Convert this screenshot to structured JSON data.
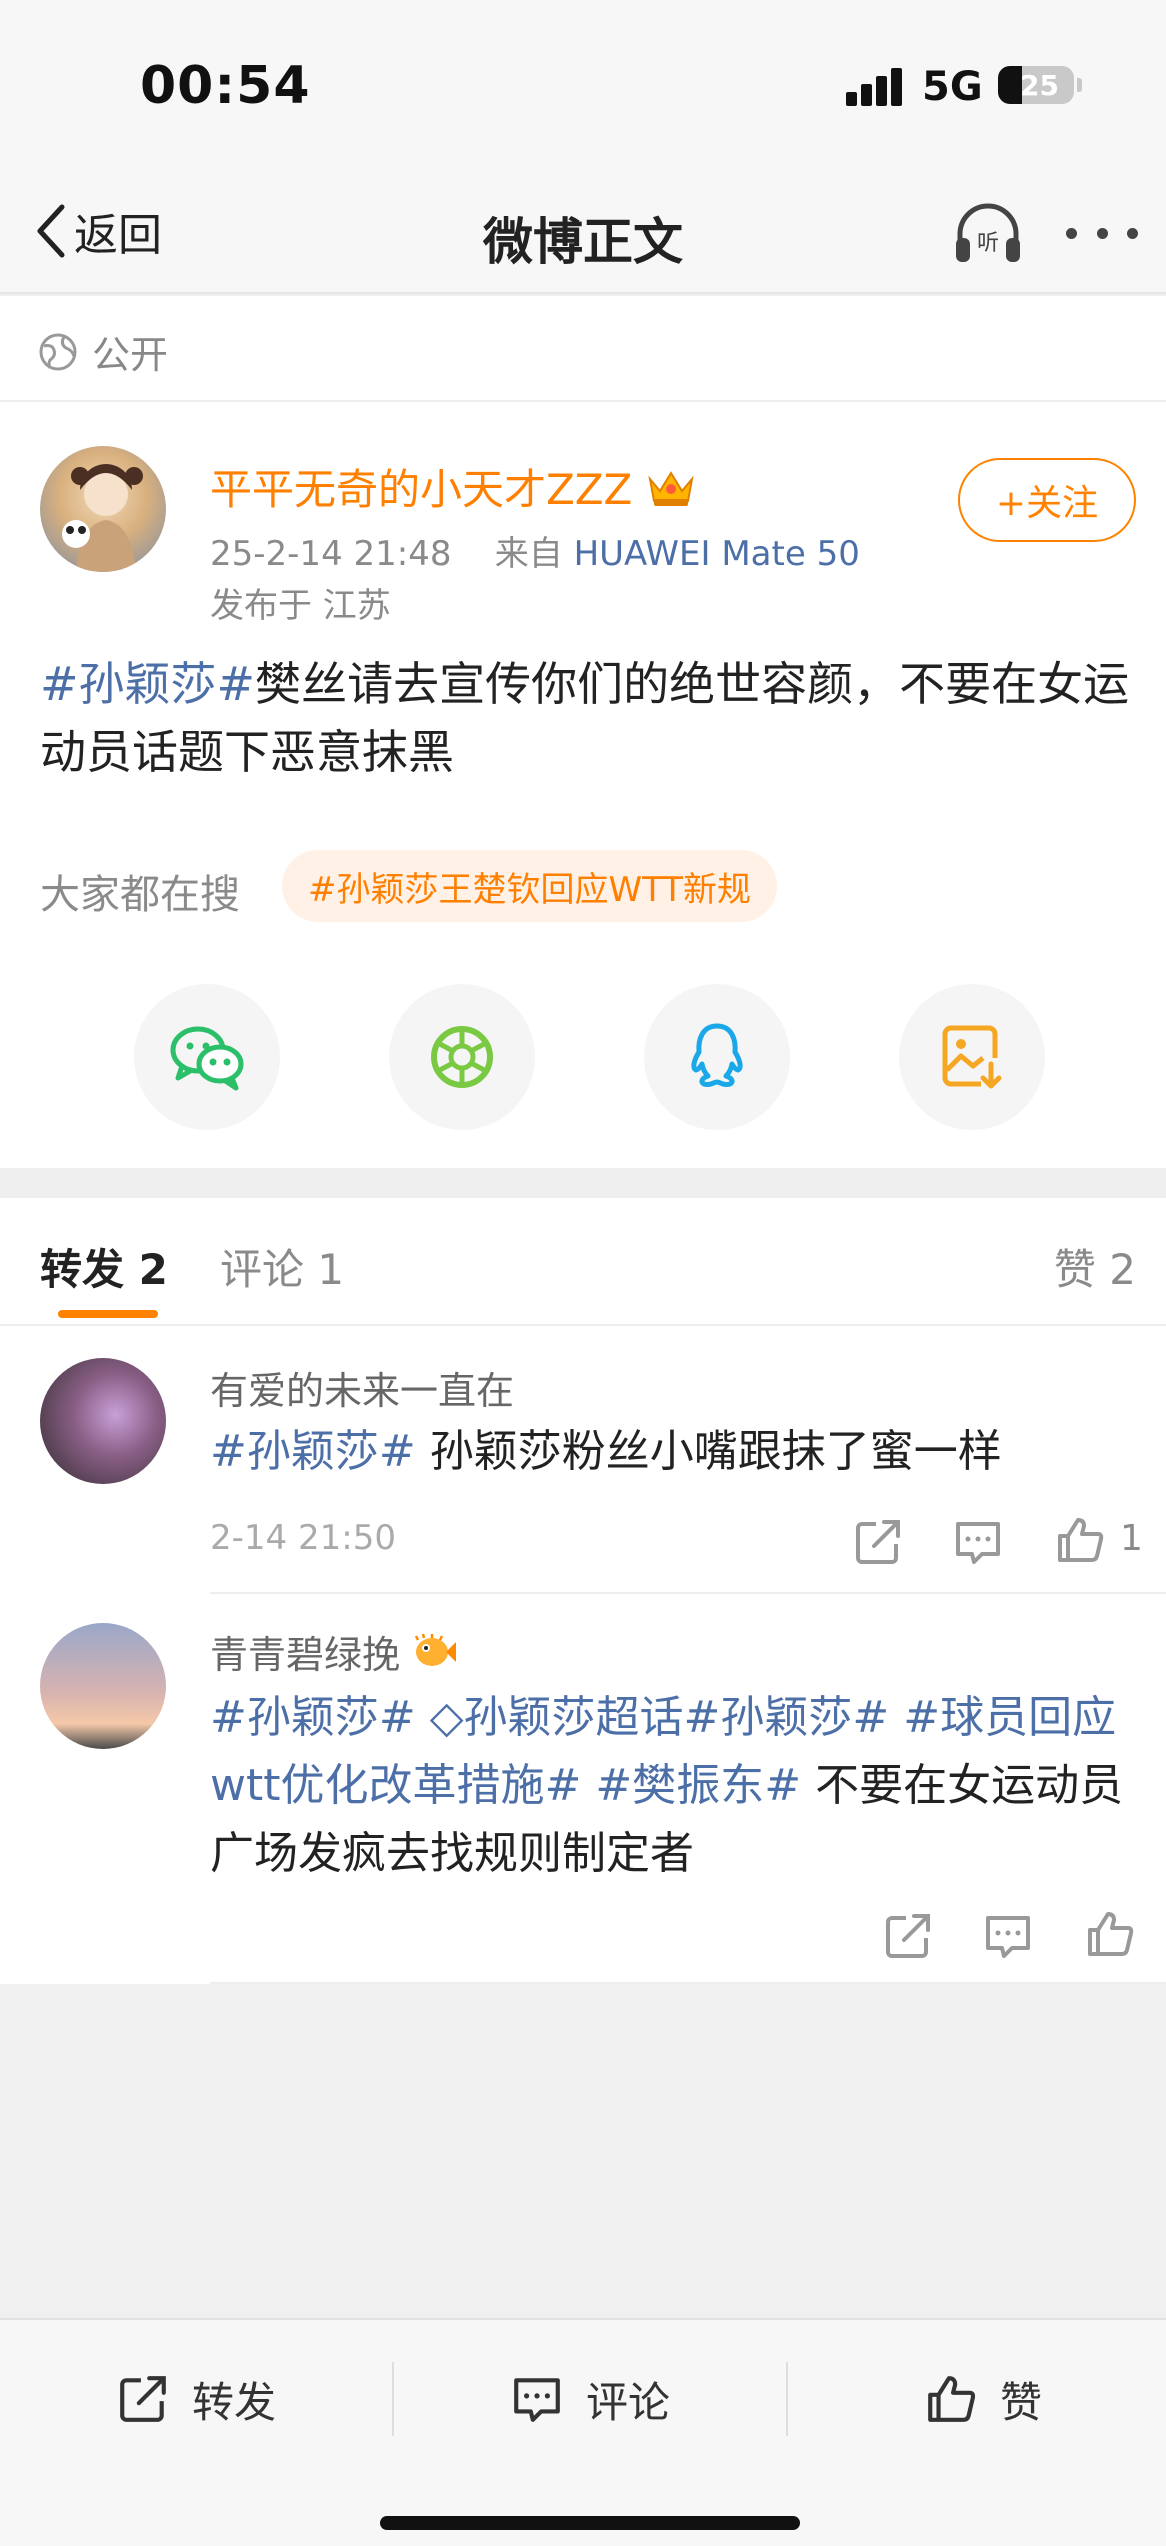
{
  "status_bar": {
    "time": "00:54",
    "network": "5G",
    "battery": "25"
  },
  "nav": {
    "back_label": "返回",
    "title": "微博正文"
  },
  "post": {
    "visibility": "公开",
    "author": "平平无奇的小天才ZZZ",
    "time": "25-2-14 21:48",
    "from_prefix": "来自",
    "device": "HUAWEI Mate 50",
    "location": "发布于 江苏",
    "follow_label": "+关注",
    "tag": "#孙颖莎#",
    "text": "樊丝请去宣传你们的绝世容颜，不要在女运动员话题下恶意抹黑"
  },
  "hot_search": {
    "label": "大家都在搜",
    "chip": "#孙颖莎王楚钦回应WTT新规"
  },
  "share_icons": [
    "wechat-icon",
    "moments-icon",
    "qq-icon",
    "save-image-icon"
  ],
  "tabs": {
    "repost": "转发 2",
    "comment": "评论 1",
    "like": "赞 2"
  },
  "reposts": [
    {
      "name": "有爱的未来一直在",
      "tag": "#孙颖莎#",
      "text": " 孙颖莎粉丝小嘴跟抹了蜜一样",
      "time": "2-14 21:50",
      "like_count": "1"
    },
    {
      "name": "青青碧绿挽",
      "tags": "#孙颖莎# ◇孙颖莎超话#孙颖莎# #球员回应wtt优化改革措施# #樊振东#",
      "text": " 不要在女运动员广场发疯去找规则制定者"
    }
  ],
  "bottom_bar": {
    "repost": "转发",
    "comment": "评论",
    "like": "赞"
  },
  "colors": {
    "accent": "#ff8200",
    "link": "#4d6fa8",
    "author": "#ff7f00"
  }
}
